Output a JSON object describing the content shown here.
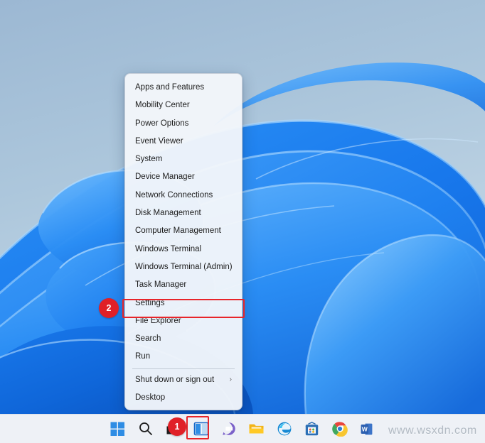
{
  "desktop": {
    "wallpaper_name": "windows-11-bloom-wallpaper",
    "background_color": "#a9c4da",
    "petal_color": "#1a7ef0"
  },
  "context_menu": {
    "name": "win-x-power-user-menu",
    "items": [
      {
        "label": "Apps and Features",
        "has_submenu": false
      },
      {
        "label": "Mobility Center",
        "has_submenu": false
      },
      {
        "label": "Power Options",
        "has_submenu": false
      },
      {
        "label": "Event Viewer",
        "has_submenu": false
      },
      {
        "label": "System",
        "has_submenu": false
      },
      {
        "label": "Device Manager",
        "has_submenu": false
      },
      {
        "label": "Network Connections",
        "has_submenu": false
      },
      {
        "label": "Disk Management",
        "has_submenu": false
      },
      {
        "label": "Computer Management",
        "has_submenu": false
      },
      {
        "label": "Windows Terminal",
        "has_submenu": false
      },
      {
        "label": "Windows Terminal (Admin)",
        "has_submenu": false
      },
      {
        "label": "Task Manager",
        "has_submenu": false
      },
      {
        "label": "Settings",
        "has_submenu": false,
        "highlighted": true
      },
      {
        "label": "File Explorer",
        "has_submenu": false
      },
      {
        "label": "Search",
        "has_submenu": false
      },
      {
        "label": "Run",
        "has_submenu": false
      },
      {
        "label": "Shut down or sign out",
        "has_submenu": true,
        "submenu_glyph": "›"
      },
      {
        "label": "Desktop",
        "has_submenu": false
      }
    ],
    "separator_before_index": 16,
    "highlight_color": "#e8252a"
  },
  "callouts": [
    {
      "label": "1",
      "target": "start-button",
      "color": "#e02027"
    },
    {
      "label": "2",
      "target": "settings-menu-item",
      "color": "#e02027"
    }
  ],
  "taskbar": {
    "background_color": "#eef1f6",
    "icons": [
      {
        "name": "start-button",
        "label": "Start",
        "icon": "windows-logo-icon"
      },
      {
        "name": "search-button",
        "label": "Search",
        "icon": "search-icon"
      },
      {
        "name": "task-view-button",
        "label": "Task View",
        "icon": "task-view-icon"
      },
      {
        "name": "widgets-button",
        "label": "Widgets",
        "icon": "widgets-icon"
      },
      {
        "name": "chat-button",
        "label": "Chat",
        "icon": "chat-icon"
      },
      {
        "name": "file-explorer-button",
        "label": "File Explorer",
        "icon": "folder-icon"
      },
      {
        "name": "edge-button",
        "label": "Microsoft Edge",
        "icon": "edge-icon"
      },
      {
        "name": "store-button",
        "label": "Microsoft Store",
        "icon": "store-icon"
      },
      {
        "name": "chrome-button",
        "label": "Google Chrome",
        "icon": "chrome-icon"
      },
      {
        "name": "word-button",
        "label": "Microsoft Word",
        "icon": "word-icon"
      }
    ]
  },
  "watermark": {
    "text": "www.wsxdn.com"
  }
}
